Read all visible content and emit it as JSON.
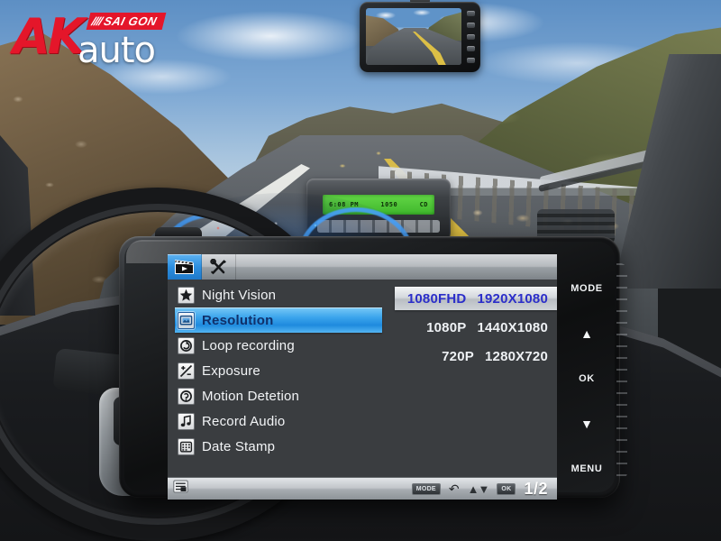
{
  "brand": {
    "name_primary": "AK",
    "name_secondary": "auto",
    "badge_slashes": "////",
    "badge_text": "SAI GON"
  },
  "car_radio": {
    "lcd_left": "6:08 PM",
    "lcd_center": "1050",
    "lcd_right": "CD"
  },
  "device": {
    "screen": {
      "tabs": [
        {
          "id": "video",
          "icon": "clapperboard-icon",
          "active": true
        },
        {
          "id": "settings",
          "icon": "tools-icon",
          "active": false
        }
      ],
      "menu_items": [
        {
          "label": "Night Vision",
          "icon": "star-icon",
          "selected": false
        },
        {
          "label": "Resolution",
          "icon": "monitor-icon",
          "selected": true
        },
        {
          "label": "Loop recording",
          "icon": "loop-icon",
          "selected": false
        },
        {
          "label": "Exposure",
          "icon": "exposure-icon",
          "selected": false
        },
        {
          "label": "Motion Detetion",
          "icon": "motion-icon",
          "selected": false
        },
        {
          "label": "Record Audio",
          "icon": "music-note-icon",
          "selected": false
        },
        {
          "label": "Date Stamp",
          "icon": "date-grid-icon",
          "selected": false
        }
      ],
      "options": [
        {
          "name": "1080FHD",
          "value": "1920X1080",
          "selected": true
        },
        {
          "name": "1080P",
          "value": "1440X1080",
          "selected": false
        },
        {
          "name": "720P",
          "value": "1280X720",
          "selected": false
        }
      ],
      "statusbar": {
        "list_icon": "list-settings-icon",
        "mode_key": "MODE",
        "back_glyph": "↶",
        "arrows_glyph": "▲▼",
        "ok_key": "OK",
        "page": "1/2"
      }
    },
    "hw_buttons": [
      {
        "label": "MODE",
        "type": "text"
      },
      {
        "label": "▲",
        "type": "glyph"
      },
      {
        "label": "OK",
        "type": "text"
      },
      {
        "label": "▼",
        "type": "glyph"
      },
      {
        "label": "MENU",
        "type": "text"
      }
    ]
  },
  "colors": {
    "brand_red": "#e4162a",
    "highlight_blue": "#3aa4ec",
    "selected_text_blue": "#2b2ec9",
    "screen_bg": "#3a3d40",
    "lcd_green": "#4fc734"
  }
}
